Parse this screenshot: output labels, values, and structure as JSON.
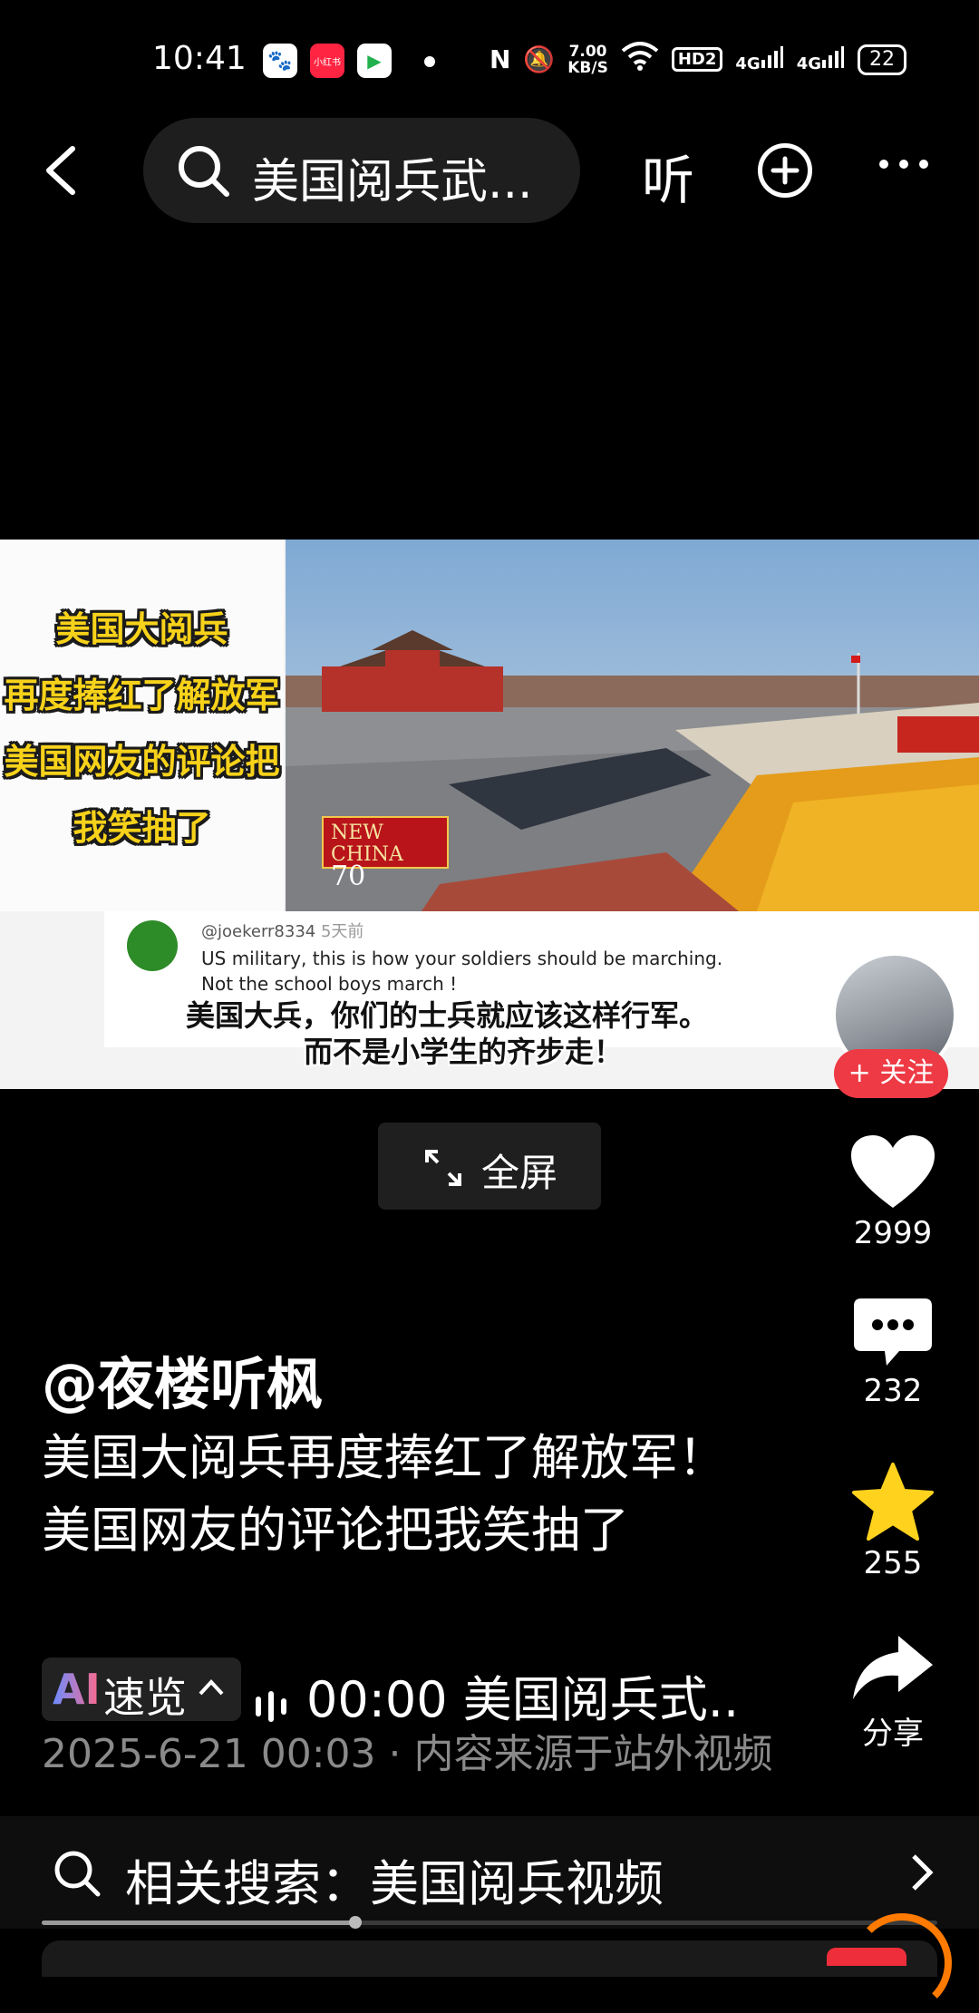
{
  "status_bar": {
    "time": "10:41",
    "app_icons": [
      "baidu-icon",
      "xiaohongshu-icon",
      "video-app-icon"
    ],
    "xhs_label": "小红书",
    "net_speed_value": "7.00",
    "net_speed_unit": "KB/S",
    "hd_label": "HD2",
    "signal_1": "4G",
    "signal_2": "4G",
    "battery": "22"
  },
  "nav": {
    "search_text": "美国阅兵武...",
    "listen_label": "听"
  },
  "video": {
    "overlay_lines": [
      "美国大阅兵",
      "再度捧红了解放军",
      "美国网友的评论把",
      "我笑抽了"
    ],
    "logo_text_1": "NEW",
    "logo_text_2": "CHINA",
    "logo_text_3": "70",
    "comment_user": "@joekerr8334",
    "comment_time": "5天前",
    "comment_en_1": "US military,  this is how  your soldiers should be marching.",
    "comment_en_2": "Not the school boys march !",
    "subtitle_1": "美国大兵，你们的士兵就应该这样行军。",
    "subtitle_2": "而不是小学生的齐步走！",
    "fullscreen_label": "全屏"
  },
  "actions": {
    "follow_label": "+ 关注",
    "like_count": "2999",
    "comment_count": "232",
    "favorite_count": "255",
    "share_label": "分享",
    "colors": {
      "like": "#ffffff",
      "favorite": "#ffd21e",
      "follow": "#ee3a44"
    }
  },
  "post": {
    "author": "@夜楼听枫",
    "description": "美国大阅兵再度捧红了解放军！美国网友的评论把我笑抽了",
    "ai_label_ai": "AI",
    "ai_label_text": "速览",
    "audio_time": "00:00",
    "audio_title": "美国阅兵式..",
    "date": "2025-6-21 00:03",
    "separator": "·",
    "source": "内容来源于站外视频"
  },
  "related": {
    "label": "相关搜索：美国阅兵视频"
  },
  "playback": {
    "progress_fraction": 0.35
  }
}
